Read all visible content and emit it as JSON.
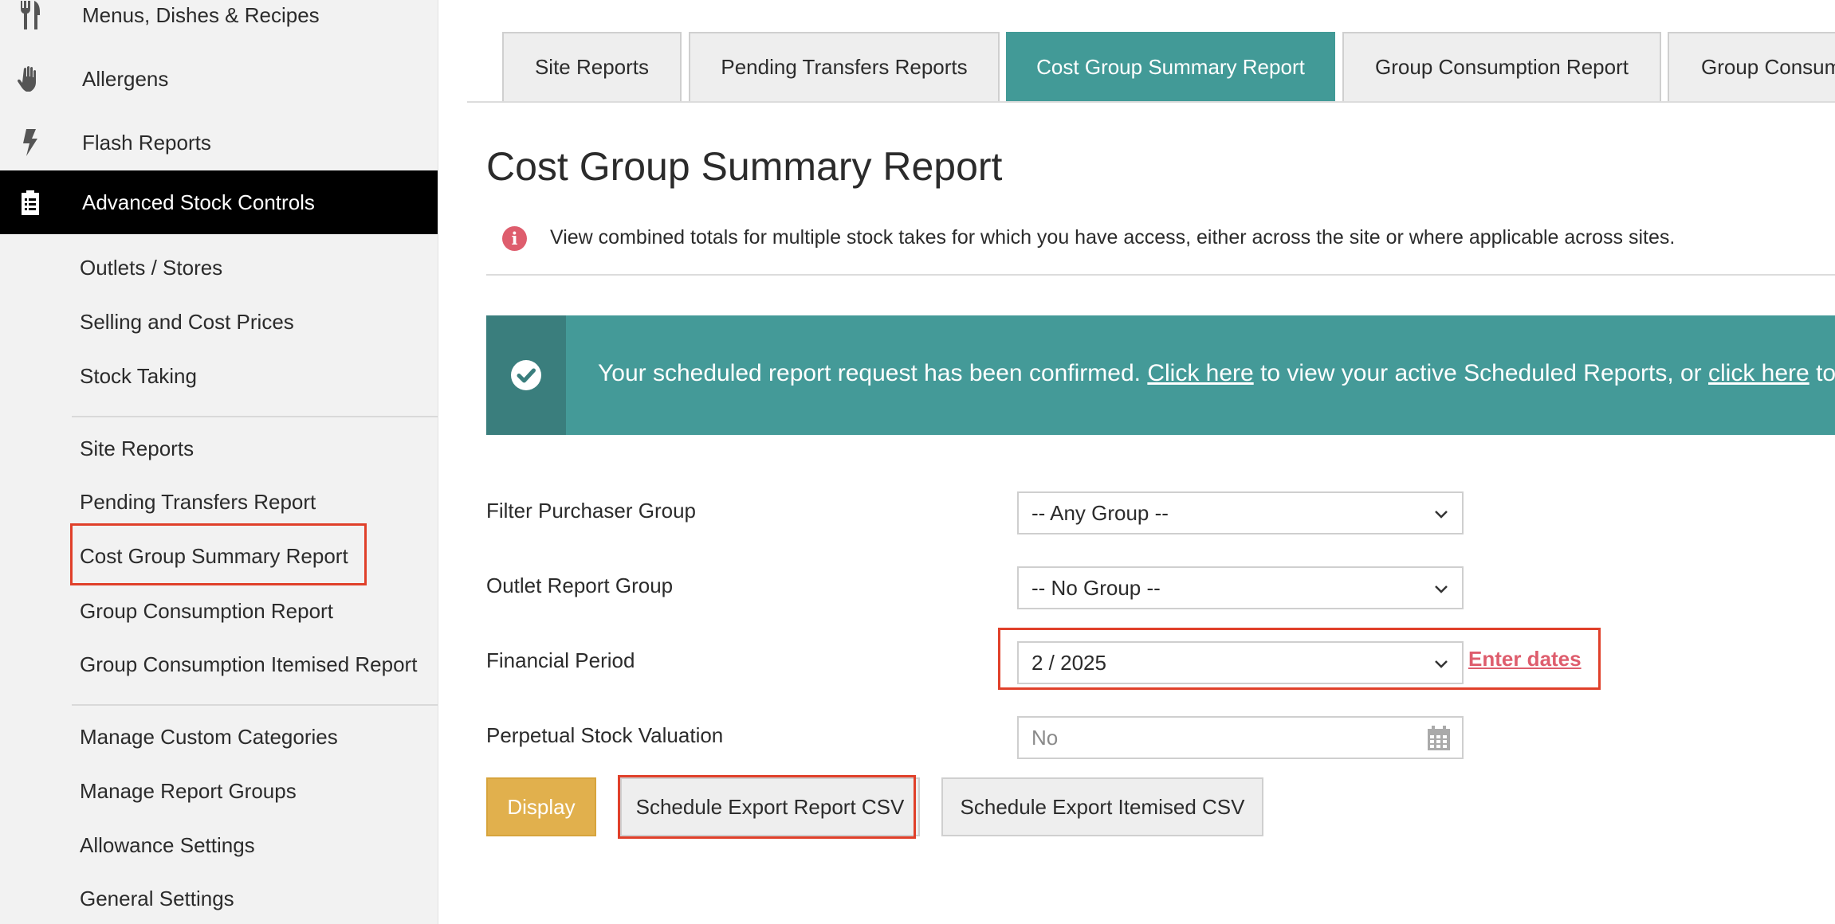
{
  "sidebar": {
    "main_items": [
      {
        "label": "Menus, Dishes & Recipes",
        "icon": "fork-knife-icon"
      },
      {
        "label": "Allergens",
        "icon": "hand-icon"
      },
      {
        "label": "Flash Reports",
        "icon": "lightning-icon"
      },
      {
        "label": "Advanced Stock Controls",
        "icon": "clipboard-icon"
      }
    ],
    "sub_items": [
      {
        "label": "Outlets / Stores"
      },
      {
        "label": "Selling and Cost Prices"
      },
      {
        "label": "Stock Taking"
      },
      {
        "label": "Site Reports"
      },
      {
        "label": "Pending Transfers Report"
      },
      {
        "label": "Cost Group Summary Report"
      },
      {
        "label": "Group Consumption Report"
      },
      {
        "label": "Group Consumption Itemised Report"
      },
      {
        "label": "Manage Custom Categories"
      },
      {
        "label": "Manage Report Groups"
      },
      {
        "label": "Allowance Settings"
      },
      {
        "label": "General Settings"
      }
    ]
  },
  "tabs": [
    {
      "label": "Site Reports"
    },
    {
      "label": "Pending Transfers Reports"
    },
    {
      "label": "Cost Group Summary Report"
    },
    {
      "label": "Group Consumption Report"
    },
    {
      "label": "Group Consum"
    }
  ],
  "page": {
    "title": "Cost Group Summary Report",
    "info_text": "View combined totals for multiple stock takes for which you have access, either across the site or where applicable across sites."
  },
  "alert": {
    "text_before": "Your scheduled report request has been confirmed.",
    "link1": "Click here",
    "text_middle": "to view your active Scheduled Reports, or",
    "link2": "click here",
    "text_after": "to"
  },
  "form": {
    "purchaser_group_label": "Filter Purchaser Group",
    "purchaser_group_value": "-- Any Group --",
    "outlet_group_label": "Outlet Report Group",
    "outlet_group_value": "-- No Group --",
    "financial_period_label": "Financial Period",
    "financial_period_value": "2 / 2025",
    "enter_dates_link": "Enter dates",
    "perpetual_label": "Perpetual Stock Valuation",
    "perpetual_value": "No"
  },
  "buttons": {
    "display": "Display",
    "schedule_report_csv": "Schedule Export Report CSV",
    "schedule_itemised_csv": "Schedule Export Itemised CSV"
  },
  "colors": {
    "accent_teal": "#429a97",
    "highlight_red": "#e0402a",
    "display_gold": "#e1b04d",
    "link_pink": "#de5d6d"
  }
}
